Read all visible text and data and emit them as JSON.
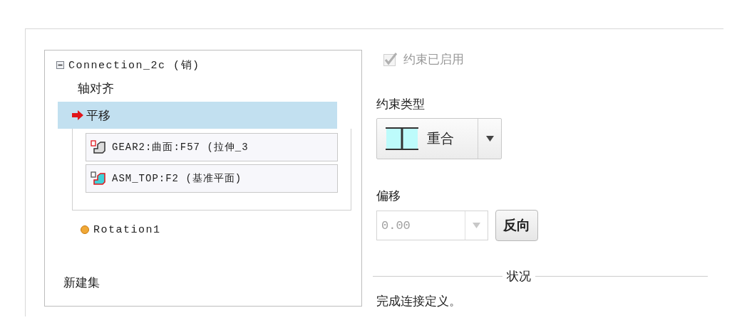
{
  "tree": {
    "label": "Connection_2c (销)",
    "expanded": true,
    "children": [
      {
        "label": "轴对齐",
        "selected": false
      },
      {
        "label": "平移",
        "selected": true,
        "references": [
          {
            "label": "GEAR2:曲面:F57 (拉伸_3",
            "kind": "surface"
          },
          {
            "label": "ASM_TOP:F2 (基准平面)",
            "kind": "plane"
          }
        ]
      }
    ]
  },
  "sets": [
    {
      "label": "Rotation1"
    }
  ],
  "new_set": "新建集",
  "constraint_enabled": {
    "label": "约束已启用",
    "checked": true,
    "disabled": true
  },
  "constraint_type": {
    "label": "约束类型",
    "value": "重合"
  },
  "offset": {
    "label": "偏移",
    "value": "0.00",
    "disabled": true
  },
  "flip_button": "反向",
  "status": {
    "title": "状况",
    "message": "完成连接定义。"
  }
}
